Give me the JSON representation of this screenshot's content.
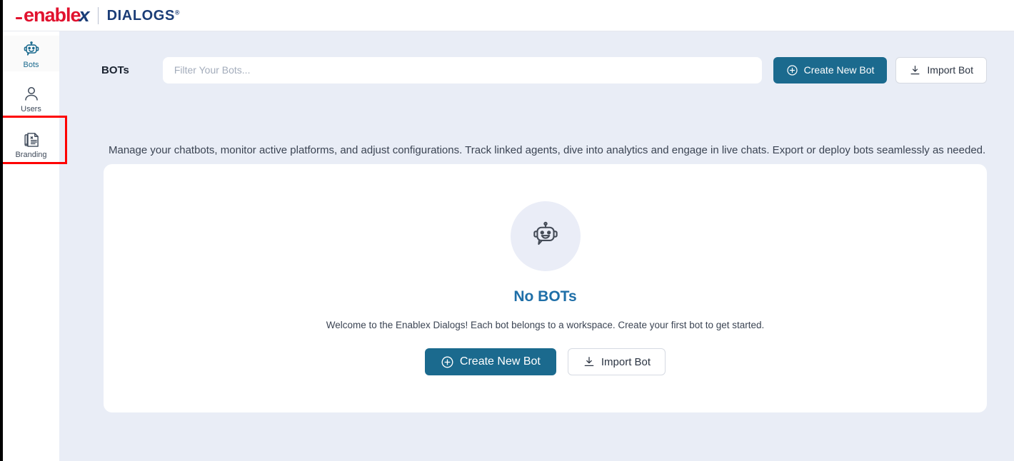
{
  "brand": {
    "name_red": "enable",
    "name_x": "x",
    "product": "DIALOGS",
    "registered": "®",
    "accent_blue": "#1b6a8e",
    "brand_red": "#e1122e",
    "brand_navy": "#1b3d77",
    "highlight_red": "#fe0000"
  },
  "sidebar": {
    "items": [
      {
        "label": "Bots",
        "icon": "robot-icon",
        "active": true
      },
      {
        "label": "Users",
        "icon": "user-icon",
        "active": false
      },
      {
        "label": "Branding",
        "icon": "branding-document-icon",
        "active": false
      }
    ]
  },
  "header": {
    "title": "BOTs",
    "search_placeholder": "Filter Your Bots...",
    "search_value": "",
    "create_label": "Create New Bot",
    "import_label": "Import Bot"
  },
  "description": "Manage your chatbots, monitor active platforms, and adjust configurations. Track linked agents, dive into analytics and engage in live chats. Export or deploy bots seamlessly as needed.",
  "empty_state": {
    "icon": "chat-bot-icon",
    "title": "No BOTs",
    "subtitle": "Welcome to the Enablex Dialogs! Each bot belongs to a workspace. Create your first bot to get started.",
    "create_label": "Create New Bot",
    "import_label": "Import Bot"
  }
}
